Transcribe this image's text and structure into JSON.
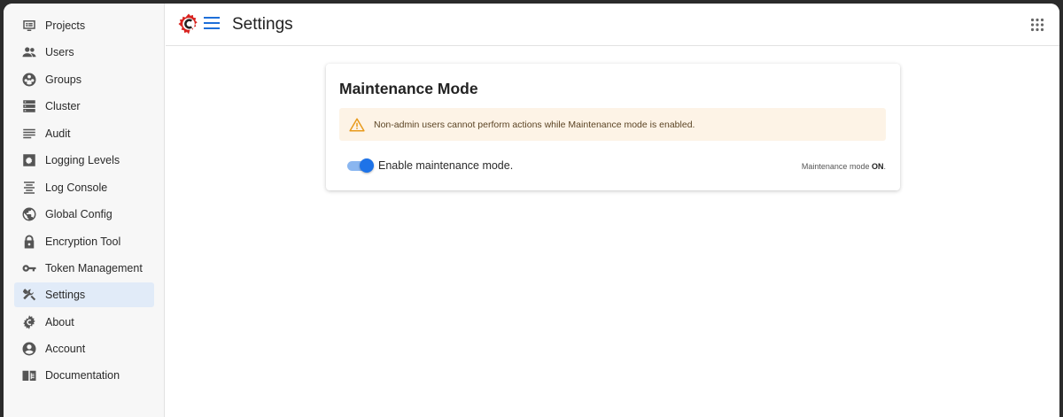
{
  "sidebar": {
    "items": [
      {
        "label": "Projects",
        "icon": "projects-icon",
        "active": false
      },
      {
        "label": "Users",
        "icon": "users-icon",
        "active": false
      },
      {
        "label": "Groups",
        "icon": "groups-icon",
        "active": false
      },
      {
        "label": "Cluster",
        "icon": "cluster-icon",
        "active": false
      },
      {
        "label": "Audit",
        "icon": "audit-icon",
        "active": false
      },
      {
        "label": "Logging Levels",
        "icon": "logging-levels-icon",
        "active": false
      },
      {
        "label": "Log Console",
        "icon": "log-console-icon",
        "active": false
      },
      {
        "label": "Global Config",
        "icon": "globe-icon",
        "active": false
      },
      {
        "label": "Encryption Tool",
        "icon": "lock-icon",
        "active": false
      },
      {
        "label": "Token Management",
        "icon": "key-icon",
        "active": false
      },
      {
        "label": "Settings",
        "icon": "tools-icon",
        "active": true
      },
      {
        "label": "About",
        "icon": "about-logo-icon",
        "active": false
      },
      {
        "label": "Account",
        "icon": "account-icon",
        "active": false
      },
      {
        "label": "Documentation",
        "icon": "documentation-icon",
        "active": false
      }
    ]
  },
  "header": {
    "title": "Settings"
  },
  "card": {
    "title": "Maintenance Mode",
    "warning": "Non-admin users cannot perform actions while Maintenance mode is enabled.",
    "toggle_label": "Enable maintenance mode.",
    "toggle_on": true,
    "status_prefix": "Maintenance mode",
    "status_value": "ON",
    "status_suffix": "."
  },
  "colors": {
    "accent": "#1e73e8",
    "active_nav_bg": "#e1ebf8",
    "warning_bg": "#fdf3e6",
    "warning_icon": "#e89a1c",
    "logo_red": "#d8231f"
  }
}
